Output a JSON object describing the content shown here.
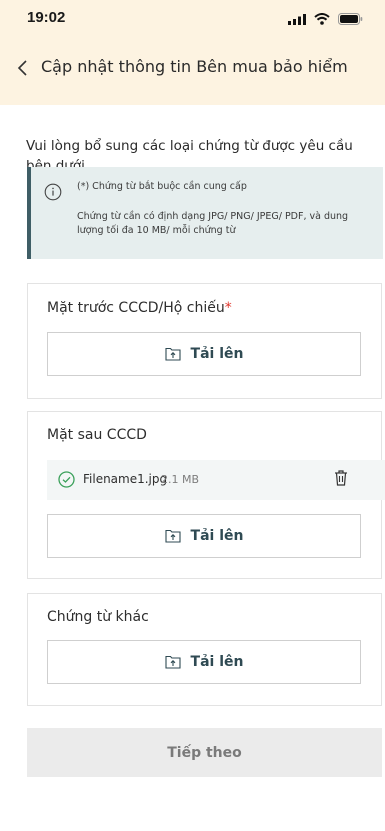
{
  "status_bar": {
    "time": "19:02"
  },
  "header": {
    "title": "Cập nhật thông tin Bên mua bảo hiểm"
  },
  "intro": "Vui lòng bổ sung các loại chứng từ được yêu cầu bên dưới",
  "notice": {
    "required_note": "(*) Chứng từ bắt buộc cần cung cấp",
    "format_note": "Chứng từ cần có định dạng JPG/ PNG/ JPEG/ PDF, và dung lượng tối đa 10 MB/ mỗi chứng từ"
  },
  "sections": [
    {
      "title": "Mặt trước CCCD/Hộ chiếu",
      "required_mark": "*",
      "upload_label": "Tải lên"
    },
    {
      "title": "Mặt sau CCCD",
      "upload_label": "Tải lên",
      "files": [
        {
          "name": "Filename1.jpg",
          "size": "2.1 MB"
        }
      ]
    },
    {
      "title": "Chứng từ khác",
      "upload_label": "Tải lên"
    }
  ],
  "footer": {
    "next_label": "Tiếp theo"
  },
  "colors": {
    "accent": "#2f4a53",
    "header_bg": "#fdf3e1",
    "notice_bg": "#e6eeee",
    "required": "#e0352b"
  },
  "icons": [
    "signal-icon",
    "wifi-icon",
    "battery-icon",
    "back-chevron-icon",
    "info-icon",
    "upload-icon",
    "check-circle-icon",
    "trash-icon"
  ]
}
